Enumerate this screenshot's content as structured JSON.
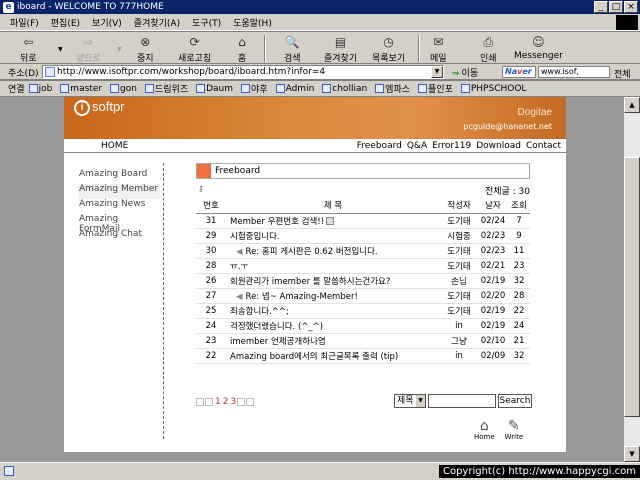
{
  "window": {
    "title": "iboard - WELCOME TO 777HOME",
    "buttons": [
      "_",
      "□",
      "×"
    ]
  },
  "menu": [
    "파일(F)",
    "편집(E)",
    "보기(V)",
    "즐겨찾기(A)",
    "도구(T)",
    "도움말(H)"
  ],
  "toolbar": {
    "back": "뒤로",
    "forward": "앞으로",
    "stop": "중지",
    "refresh": "새로고침",
    "home": "홈",
    "search": "검색",
    "favorites": "즐겨찾기",
    "history": "목록보기",
    "mail": "메일",
    "print": "인쇄",
    "messenger": "Messenger"
  },
  "address": {
    "label": "주소(D)",
    "url": "http://www.isoftpr.com/workshop/board/iboard.htm?infor=4",
    "go": "이동",
    "naver_search": "www.isof,",
    "all": "전체"
  },
  "links": {
    "label": "연결",
    "items": [
      "job",
      "master",
      "gon",
      "드림위즈",
      "Daum",
      "야후",
      "Admin",
      "chollian",
      "엠파스",
      "플인포",
      "PHPSCHOOL"
    ]
  },
  "site": {
    "logo": "softpr",
    "brand": "Dogitae",
    "email": "pcguide@hananet.net",
    "nav_home": "HOME",
    "nav_right": [
      "Freeboard",
      "Q&A",
      "Error119",
      "Download",
      "Contact"
    ]
  },
  "sidebar": {
    "items": [
      "Amazing Board",
      "Amazing Member",
      "Amazing News",
      "Amazing FormMail",
      "Amazing Chat"
    ],
    "active": 1
  },
  "board": {
    "title": "Freeboard",
    "total_label": "전체글 : 30",
    "headers": [
      "번호",
      "제  목",
      "작성자",
      "날자",
      "조회"
    ],
    "rows": [
      {
        "num": "31",
        "title": "Member 우편번호 검색!!",
        "reply": false,
        "new": true,
        "author": "도기태",
        "date": "02/24",
        "views": "7"
      },
      {
        "num": "29",
        "title": "시험중입니다.",
        "reply": false,
        "new": false,
        "author": "시험중",
        "date": "02/23",
        "views": "9"
      },
      {
        "num": "30",
        "title": "Re: 홈피 게시판은 0.62 버전입니다.",
        "reply": true,
        "new": false,
        "author": "도기태",
        "date": "02/23",
        "views": "11"
      },
      {
        "num": "28",
        "title": "ㅠ.ㅜ",
        "reply": false,
        "new": false,
        "author": "도기태",
        "date": "02/21",
        "views": "23"
      },
      {
        "num": "26",
        "title": "회원관리가 imember 를 말씀하시는건가요?",
        "reply": false,
        "new": false,
        "author": "손님",
        "date": "02/19",
        "views": "32"
      },
      {
        "num": "27",
        "title": "Re: 넵~ Amazing-Member!",
        "reply": true,
        "new": false,
        "author": "도기태",
        "date": "02/20",
        "views": "28"
      },
      {
        "num": "25",
        "title": "죄송합니다.^^;",
        "reply": false,
        "new": false,
        "author": "도기태",
        "date": "02/19",
        "views": "22"
      },
      {
        "num": "24",
        "title": "걱정했더랬습니다. (^_^)",
        "reply": false,
        "new": false,
        "author": "in",
        "date": "02/19",
        "views": "24"
      },
      {
        "num": "23",
        "title": "imember 언제공개하나염",
        "reply": false,
        "new": false,
        "author": "그냥",
        "date": "02/10",
        "views": "21"
      },
      {
        "num": "22",
        "title": "Amazing board에서의 최근글목록 출력 (tip)",
        "reply": false,
        "new": false,
        "author": "in",
        "date": "02/09",
        "views": "32"
      }
    ],
    "pages": [
      "1",
      "2",
      "3"
    ],
    "search_select": "제목",
    "search_button": "Search",
    "home_label": "Home",
    "write_label": "Write"
  },
  "status": {
    "copyright": "Copyright(c) http://www.happycgi.com"
  }
}
